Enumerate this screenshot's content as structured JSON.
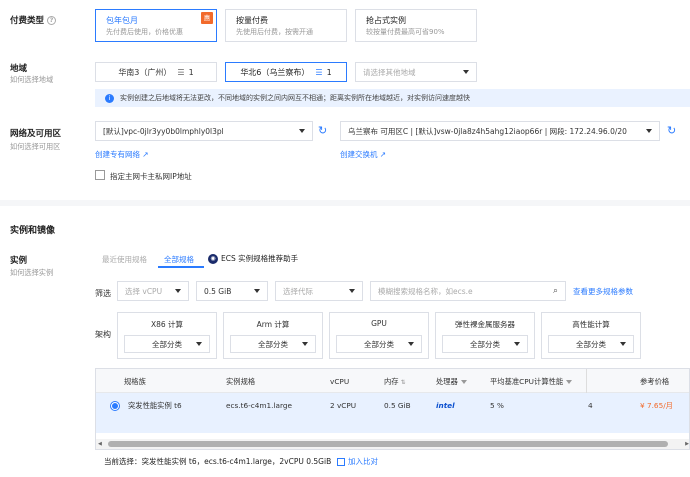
{
  "billing": {
    "label": "付费类型",
    "options": [
      {
        "title": "包年包月",
        "desc": "先付费后使用，价格优惠",
        "badge": "惠"
      },
      {
        "title": "按量付费",
        "desc": "先使用后付费，按需开通"
      },
      {
        "title": "抢占式实例",
        "desc": "较按量付费最高可省90%"
      }
    ]
  },
  "region": {
    "label": "地域",
    "sub": "如何选择地域",
    "options": [
      {
        "name": "华南3（广州）",
        "count": "1"
      },
      {
        "name": "华北6（乌兰察布）",
        "count": "1"
      }
    ],
    "other_placeholder": "请选择其他地域",
    "notice": "实例创建之后地域将无法更改，不同地域的实例之间内网互不相通；距离实例所在地域越近，对实例访问速度越快"
  },
  "network": {
    "label": "网络及可用区",
    "sub": "如何选择可用区",
    "vpc": "[默认]vpc-0jlr3yy0b0lmphly0l3pl",
    "vswitch": "乌兰察布 可用区C | [默认]vsw-0jla8z4h5ahg12iaop66r | 网段: 172.24.96.0/20",
    "create_vpc": "创建专有网络",
    "create_vswitch": "创建交换机",
    "checkbox_label": "指定主网卡主私网IP地址"
  },
  "instance_section": {
    "title": "实例和镜像"
  },
  "instance": {
    "label": "实例",
    "sub": "如何选择实例",
    "tabs": [
      "最近使用规格",
      "全部规格"
    ],
    "assistant": "ECS 实例规格推荐助手"
  },
  "filter": {
    "label": "筛选",
    "vcpu": "选择 vCPU",
    "memory": "0.5 GiB",
    "generation": "选择代际",
    "search_placeholder": "模糊搜索规格名称，如ecs.e",
    "more_link": "查看更多规格参数"
  },
  "arch": {
    "label": "架构",
    "items": [
      {
        "name": "X86 计算",
        "filter": "全部分类"
      },
      {
        "name": "Arm 计算",
        "filter": "全部分类"
      },
      {
        "name": "GPU",
        "filter": "全部分类"
      },
      {
        "name": "弹性裸金属服务器",
        "filter": "全部分类"
      },
      {
        "name": "高性能计算",
        "filter": "全部分类"
      }
    ]
  },
  "table": {
    "headers": {
      "family": "规格族",
      "spec": "实例规格",
      "vcpu": "vCPU",
      "memory": "内存",
      "cpu": "处理器",
      "baseline": "平均基准CPU计算性能",
      "price": "参考价格"
    },
    "row": {
      "family": "突发性能实例 t6",
      "spec": "ecs.t6-c4m1.large",
      "vcpu": "2 vCPU",
      "memory": "0.5 GiB",
      "cpu": "intel",
      "baseline": "5 %",
      "extra": "4",
      "price": "¥ 7.65/月"
    }
  },
  "current": {
    "text": "当前选择：突发性能实例 t6，ecs.t6-c4m1.large，2vCPU 0.5GiB",
    "compare": "加入比对"
  },
  "colors": {
    "accent": "#2b7bff",
    "price": "#f26a2b",
    "selected_row": "#e8f1ff"
  }
}
